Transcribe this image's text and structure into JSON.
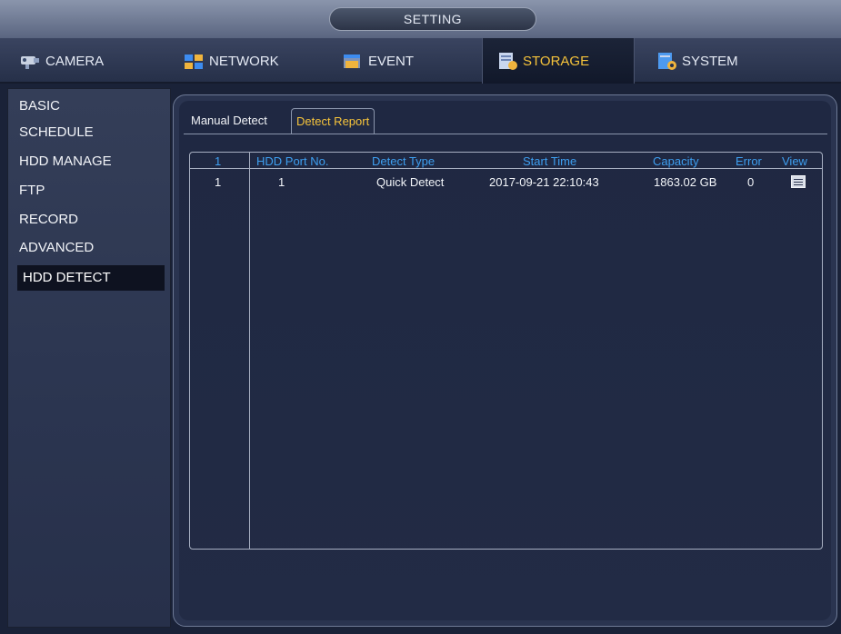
{
  "window": {
    "title": "SETTING"
  },
  "main_tabs": [
    {
      "label": "CAMERA",
      "icon": "camera-icon"
    },
    {
      "label": "NETWORK",
      "icon": "network-icon"
    },
    {
      "label": "EVENT",
      "icon": "event-icon"
    },
    {
      "label": "STORAGE",
      "icon": "storage-icon",
      "active": true
    },
    {
      "label": "SYSTEM",
      "icon": "system-icon"
    }
  ],
  "sidebar": {
    "items": [
      {
        "label": "BASIC"
      },
      {
        "label": "SCHEDULE"
      },
      {
        "label": "HDD MANAGE"
      },
      {
        "label": "FTP"
      },
      {
        "label": "RECORD"
      },
      {
        "label": "ADVANCED"
      },
      {
        "label": "HDD DETECT",
        "active": true
      }
    ]
  },
  "sub_tabs": {
    "manual": "Manual Detect",
    "report": "Detect Report",
    "active": "report"
  },
  "table": {
    "headers": [
      "1",
      "HDD Port No.",
      "Detect Type",
      "Start Time",
      "Capacity",
      "Error",
      "View"
    ],
    "rows": [
      {
        "index": "1",
        "port": "1",
        "type": "Quick Detect",
        "start": "2017-09-21 22:10:43",
        "capacity": "1863.02 GB",
        "error": "0",
        "view_icon": "details-icon"
      }
    ]
  },
  "colors": {
    "accent": "#f5c33b",
    "header_text": "#3e9ff0",
    "background": "#1f2842"
  }
}
